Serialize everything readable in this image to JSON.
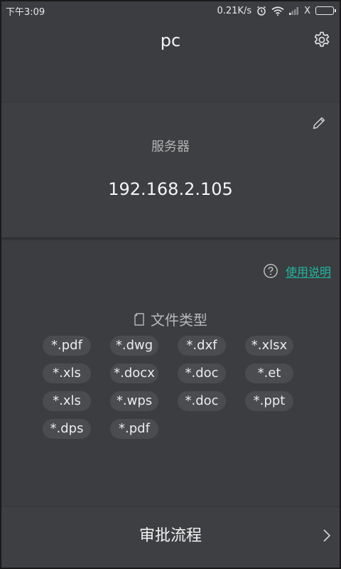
{
  "status_bar": {
    "time": "下午3:09",
    "net_speed": "0.21K/s",
    "icons": [
      "alarm-icon",
      "wifi-icon",
      "signal-icon",
      "no-sim-icon",
      "battery-icon"
    ],
    "no_sim_glyph": "X"
  },
  "header": {
    "title": "pc",
    "settings_icon": "gear-icon"
  },
  "server": {
    "label": "服务器",
    "ip": "192.168.2.105",
    "edit_icon": "pencil-icon"
  },
  "file_types": {
    "help_link": "使用说明",
    "title": "文件类型",
    "items": [
      "*.pdf",
      "*.dwg",
      "*.dxf",
      "*.xlsx",
      "*.xls",
      "*.docx",
      "*.doc",
      "*.et",
      "*.xls",
      "*.wps",
      "*.doc",
      "*.ppt",
      "*.dps",
      "*.pdf"
    ]
  },
  "approval": {
    "label": "审批流程"
  },
  "colors": {
    "background": "#3b3d40",
    "chip": "#4a4c50",
    "accent_link": "#1fb8a2"
  }
}
